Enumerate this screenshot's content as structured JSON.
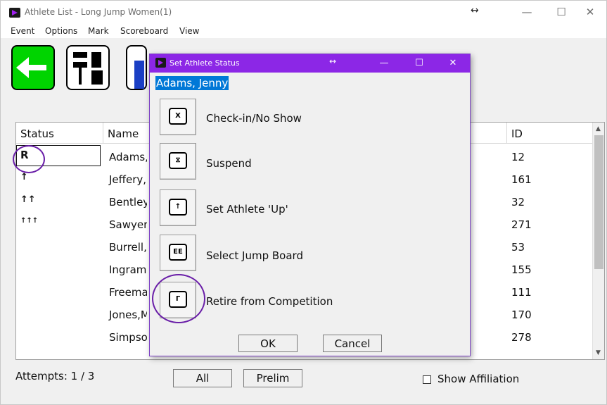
{
  "window": {
    "title": "Athlete List - Long Jump Women(1)",
    "resize_icon": "↔",
    "minimize": "—",
    "maximize": "☐",
    "close": "✕"
  },
  "menu": [
    "Event",
    "Options",
    "Mark",
    "Scoreboard",
    "View"
  ],
  "table": {
    "headers": {
      "status": "Status",
      "name": "Name",
      "id": "ID"
    },
    "rows": [
      {
        "status": "R",
        "name": "Adams,",
        "id": "12"
      },
      {
        "status": "↑",
        "name": "Jeffery,",
        "id": "161"
      },
      {
        "status": "↑↑",
        "name": "Bentley,",
        "id": "32"
      },
      {
        "status": "↑↑↑",
        "name": "Sawyer,",
        "id": "271"
      },
      {
        "status": "",
        "name": "Burrell,",
        "id": "53"
      },
      {
        "status": "",
        "name": "Ingram,",
        "id": "155"
      },
      {
        "status": "",
        "name": "Freeman",
        "id": "111"
      },
      {
        "status": "",
        "name": "Jones,M",
        "id": "170"
      },
      {
        "status": "",
        "name": "Simpson",
        "id": "278"
      }
    ]
  },
  "bottom": {
    "attempts": "Attempts: 1 / 3",
    "all_button": "All",
    "prelim_button": "Prelim",
    "show_affiliation": "Show Affiliation"
  },
  "dialog": {
    "title": "Set Athlete Status",
    "resize_icon": "↔",
    "minimize": "—",
    "maximize": "☐",
    "close": "✕",
    "athlete": "Adams, Jenny",
    "actions": [
      {
        "label": "Check-in/No Show",
        "icon": "checkin-icon",
        "glyph": "X"
      },
      {
        "label": "Suspend",
        "icon": "suspend-icon",
        "glyph": "⧖"
      },
      {
        "label": "Set Athlete 'Up'",
        "icon": "athlete-up-icon",
        "glyph": "↑"
      },
      {
        "label": "Select Jump Board",
        "icon": "jump-board-icon",
        "glyph": "EE"
      },
      {
        "label": "Retire from Competition",
        "icon": "retire-icon",
        "glyph": "Γ"
      }
    ],
    "ok": "OK",
    "cancel": "Cancel"
  },
  "colors": {
    "dialog_title": "#8c27e6",
    "highlight": "#0078d7",
    "annotation_circle": "#6a1fa8",
    "back_button": "#00d400"
  }
}
